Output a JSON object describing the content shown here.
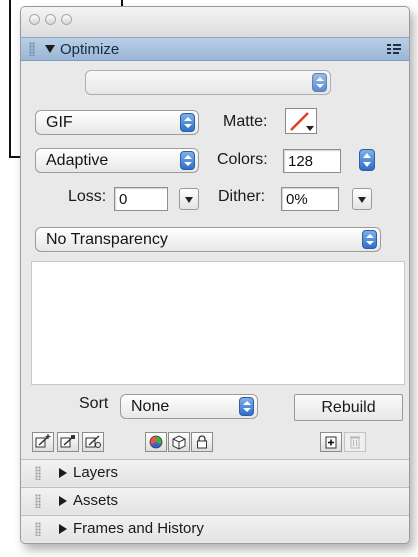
{
  "window": {
    "panel_title": "Optimize"
  },
  "settings": {
    "top_preset": "",
    "format": "GIF",
    "matte_label": "Matte:",
    "palette": "Adaptive",
    "colors_label": "Colors:",
    "colors_value": "128",
    "loss_label": "Loss:",
    "loss_value": "0",
    "dither_label": "Dither:",
    "dither_value": "0%",
    "transparency": "No Transparency"
  },
  "footer": {
    "sort_label": "Sort",
    "sort_value": "None",
    "rebuild_label": "Rebuild"
  },
  "sections": [
    {
      "label": "Layers"
    },
    {
      "label": "Assets"
    },
    {
      "label": "Frames and History"
    }
  ],
  "colors": {
    "header_blue": "#a9c3e0",
    "stepper_blue": "#3b78d0",
    "matte_slash": "#e0402a"
  }
}
